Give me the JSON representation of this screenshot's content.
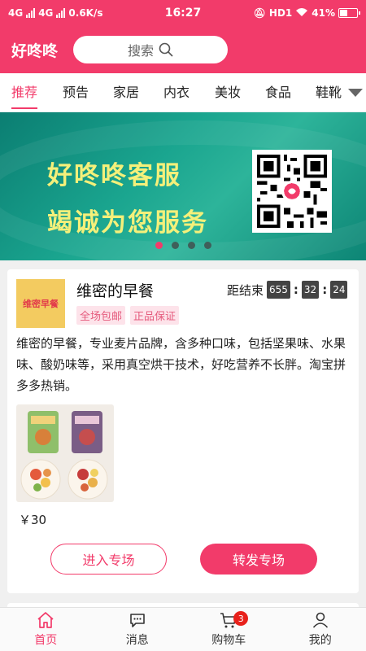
{
  "statusbar": {
    "net1": "4G",
    "net2": "4G",
    "speed": "0.6K/s",
    "time": "16:27",
    "hd": "HD1",
    "battery": "41%"
  },
  "header": {
    "brand": "好咚咚",
    "search_placeholder": "搜索"
  },
  "tabs": [
    "推荐",
    "预告",
    "家居",
    "内衣",
    "美妆",
    "食品",
    "鞋靴"
  ],
  "banner": {
    "line1": "好咚咚客服",
    "line2": "竭诚为您服务",
    "dots": 4,
    "active_dot": 0
  },
  "card": {
    "logo_text": "维密早餐",
    "title": "维密的早餐",
    "countdown_label": "距结束",
    "countdown": [
      "655",
      "32",
      "24"
    ],
    "tags": [
      "全场包邮",
      "正品保证"
    ],
    "description": "维密的早餐，专业麦片品牌，含多种口味，包括坚果味、水果味、酸奶味等，采用真空烘干技术，好吃营养不长胖。淘宝拼多多热销。",
    "price": "￥30",
    "enter_label": "进入专场",
    "share_label": "转发专场"
  },
  "nav": {
    "home": "首页",
    "messages": "消息",
    "cart": "购物车",
    "cart_badge": "3",
    "mine": "我的"
  },
  "colors": {
    "accent": "#f23b6a",
    "banner_text": "#f4f07a",
    "banner_bg": "#1aa58f"
  }
}
